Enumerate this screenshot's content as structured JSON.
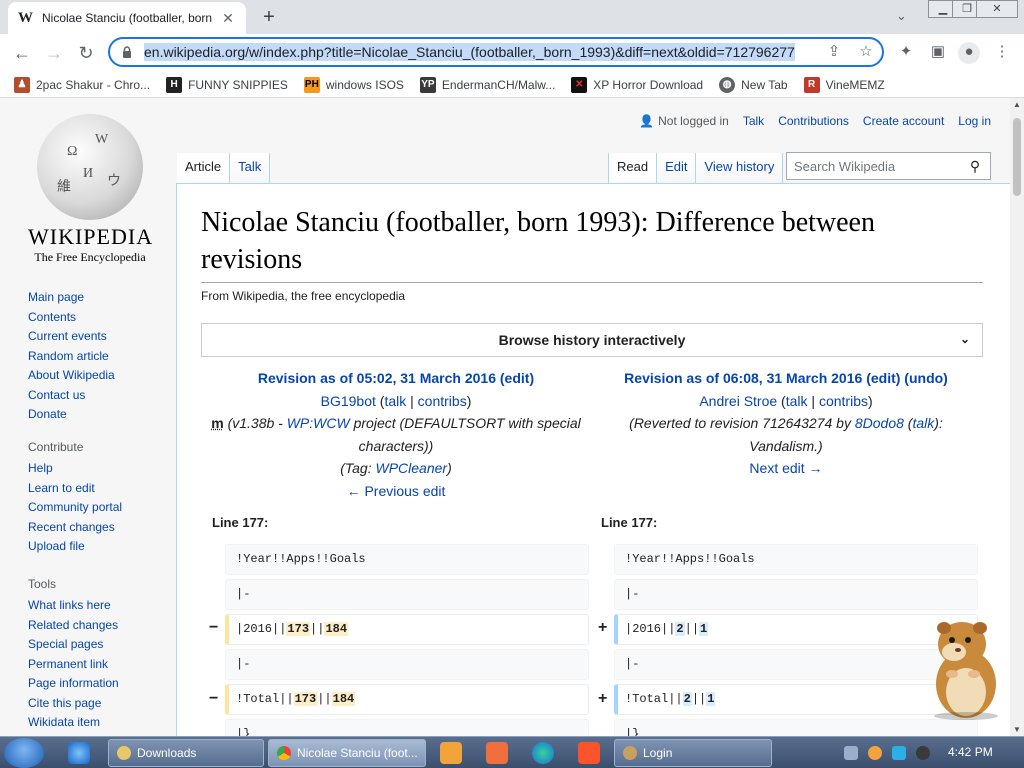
{
  "browser": {
    "tab_title": "Nicolae Stanciu (footballer, born",
    "tab_favicon": "W",
    "url": "en.wikipedia.org/w/index.php?title=Nicolae_Stanciu_(footballer,_born_1993)&diff=next&oldid=712796277",
    "bookmarks": [
      {
        "label": "2pac Shakur - Chro...",
        "icon": "user-icon",
        "color": "#b34d2b"
      },
      {
        "label": "FUNNY SNIPPIES",
        "icon": "H",
        "color": "#222222"
      },
      {
        "label": "windows ISOS",
        "icon": "PH",
        "color": "#f7971d"
      },
      {
        "label": "EndermanCH/Malw...",
        "icon": "YP",
        "color": "#3a3a3a"
      },
      {
        "label": "XP Horror Download",
        "icon": "X",
        "color": "#c41e1e"
      },
      {
        "label": "New Tab",
        "icon": "globe-icon",
        "color": "#5f6368"
      },
      {
        "label": "VineMEMZ",
        "icon": "R",
        "color": "#c0392b"
      }
    ]
  },
  "wiki": {
    "logo_wordmark": "WIKIPEDIA",
    "logo_tagline": "The Free Encyclopedia",
    "personal": {
      "not_logged_in": "Not logged in",
      "talk": "Talk",
      "contributions": "Contributions",
      "create_account": "Create account",
      "log_in": "Log in"
    },
    "tabs": {
      "article": "Article",
      "talk": "Talk",
      "read": "Read",
      "edit": "Edit",
      "view_history": "View history"
    },
    "search_placeholder": "Search Wikipedia",
    "nav": [
      "Main page",
      "Contents",
      "Current events",
      "Random article",
      "About Wikipedia",
      "Contact us",
      "Donate"
    ],
    "contribute_heading": "Contribute",
    "contribute": [
      "Help",
      "Learn to edit",
      "Community portal",
      "Recent changes",
      "Upload file"
    ],
    "tools_heading": "Tools",
    "tools": [
      "What links here",
      "Related changes",
      "Special pages",
      "Permanent link",
      "Page information",
      "Cite this page",
      "Wikidata item"
    ],
    "heading": "Nicolae Stanciu (footballer, born 1993): Difference between revisions",
    "site_sub": "From Wikipedia, the free encyclopedia",
    "browse_history": "Browse history interactively",
    "left_rev": {
      "title": "Revision as of 05:02, 31 March 2016",
      "edit": "(edit)",
      "user": "BG19bot",
      "talk": "talk",
      "contribs": "contribs",
      "minor": "m",
      "summary_pre": "(v1.38b - ",
      "summary_link": "WP:WCW",
      "summary_post": " project (DEFAULTSORT with special characters))",
      "tag_pre": "(Tag: ",
      "tag_link": "WPCleaner",
      "tag_post": ")",
      "nav": "← Previous edit"
    },
    "right_rev": {
      "title": "Revision as of 06:08, 31 March 2016",
      "edit": "(edit)",
      "undo": "(undo)",
      "user": "Andrei Stroe",
      "talk": "talk",
      "contribs": "contribs",
      "summary_pre": "(Reverted to revision 712643274 by ",
      "summary_user": "8Dodo8",
      "summary_talk": "talk",
      "summary_post": ": Vandalism.)",
      "nav": "Next edit →"
    },
    "line_label": "Line 177:",
    "diff": {
      "context1": "!Year!!Apps!!Goals",
      "context2": "|-",
      "row1_prefix": "|2016||",
      "row1_old_a": "173",
      "row1_sep": "||",
      "row1_old_b": "184",
      "row1_new_a": "2",
      "row1_new_b": "1",
      "context3": "|-",
      "row2_prefix": "!Total||",
      "row2_old_a": "173",
      "row2_sep": "||",
      "row2_old_b": "184",
      "row2_new_a": "2",
      "row2_new_b": "1",
      "context4": "|}",
      "minus": "−",
      "plus": "+"
    }
  },
  "taskbar": {
    "items": [
      "Downloads",
      "Nicolae Stanciu (foot...",
      "Login"
    ],
    "clock": "4:42 PM"
  }
}
